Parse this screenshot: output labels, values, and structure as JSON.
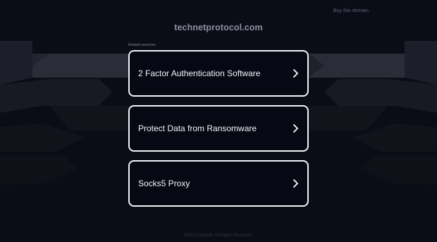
{
  "header": {
    "buy_link": "Buy this domain.",
    "domain": "technetprotocol.com"
  },
  "main": {
    "related_label": "Related searches",
    "results": [
      {
        "label": "2 Factor Authentication Software",
        "icon": "chevron-right-icon"
      },
      {
        "label": "Protect Data from Ransomware",
        "icon": "chevron-right-icon"
      },
      {
        "label": "Socks5 Proxy",
        "icon": "chevron-right-icon"
      }
    ]
  },
  "footer": {
    "copyright": "2025 Copyright. All Rights Reserved."
  },
  "colors": {
    "background": "#0b0d16",
    "card_border": "#f2f3f7",
    "card_background": "#060813",
    "text": "#f4f5f8"
  }
}
